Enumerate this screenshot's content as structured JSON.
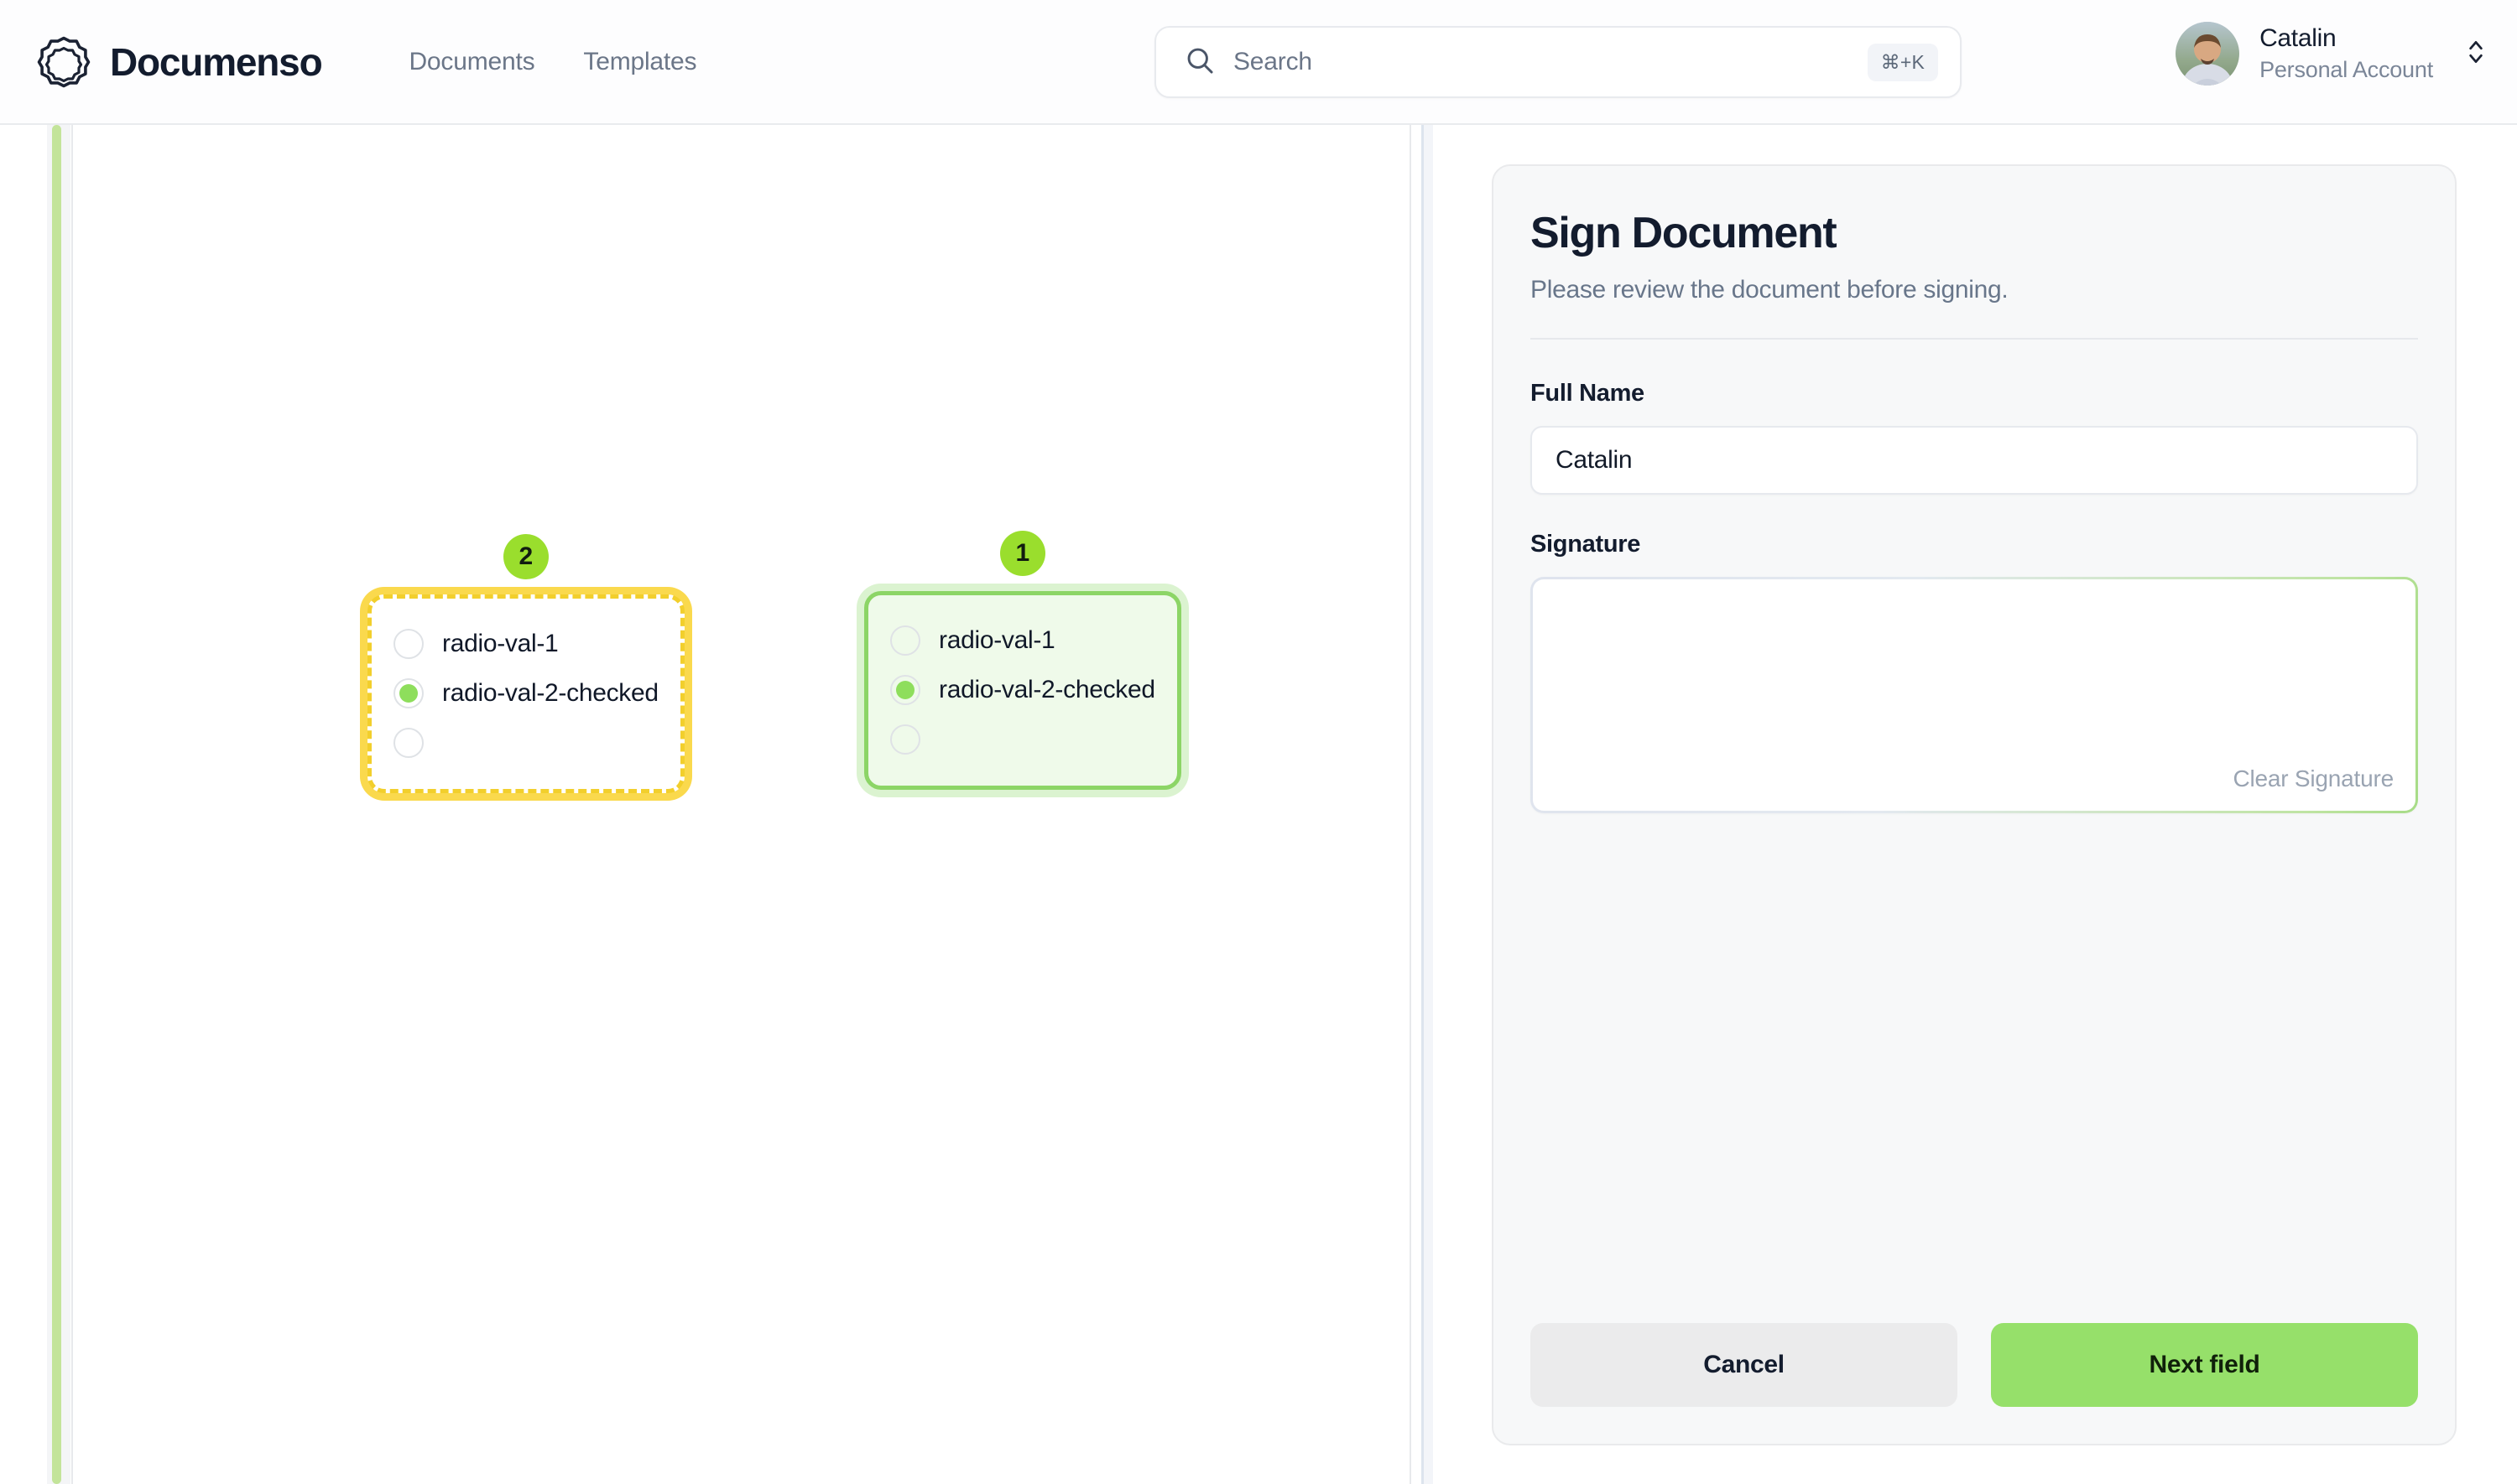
{
  "header": {
    "brand_name": "Documenso",
    "logo_icon": "documenso-scalloped-logo-icon",
    "nav": [
      {
        "label": "Documents"
      },
      {
        "label": "Templates"
      }
    ],
    "search": {
      "icon": "search-icon",
      "placeholder": "Search",
      "value": "",
      "shortcut": "⌘+K"
    },
    "user": {
      "name": "Catalin",
      "account_type": "Personal Account",
      "avatar_icon": "user-avatar-photo",
      "chevron_icon": "chevron-up-down-icon"
    }
  },
  "document": {
    "fields": [
      {
        "badge": "2",
        "state": "pending",
        "state_color": "#fad63e",
        "options": [
          {
            "label": "radio-val-1",
            "checked": false
          },
          {
            "label": "radio-val-2-checked",
            "checked": true
          },
          {
            "label": "",
            "checked": false
          }
        ]
      },
      {
        "badge": "1",
        "state": "signed",
        "state_color": "#8cd566",
        "options": [
          {
            "label": "radio-val-1",
            "checked": false
          },
          {
            "label": "radio-val-2-checked",
            "checked": true
          },
          {
            "label": "",
            "checked": false
          }
        ]
      }
    ]
  },
  "sign_panel": {
    "title": "Sign Document",
    "subtitle": "Please review the document before signing.",
    "full_name_label": "Full Name",
    "full_name_value": "Catalin",
    "full_name_placeholder": "",
    "signature_label": "Signature",
    "clear_signature_label": "Clear Signature",
    "cancel_label": "Cancel",
    "next_field_label": "Next field"
  },
  "colors": {
    "accent_green": "#96e06a",
    "badge_green": "#9ade2d",
    "pending_yellow": "#fad63e",
    "signed_green": "#8cd566",
    "text_dark": "#131c2e",
    "text_muted": "#68768a"
  }
}
